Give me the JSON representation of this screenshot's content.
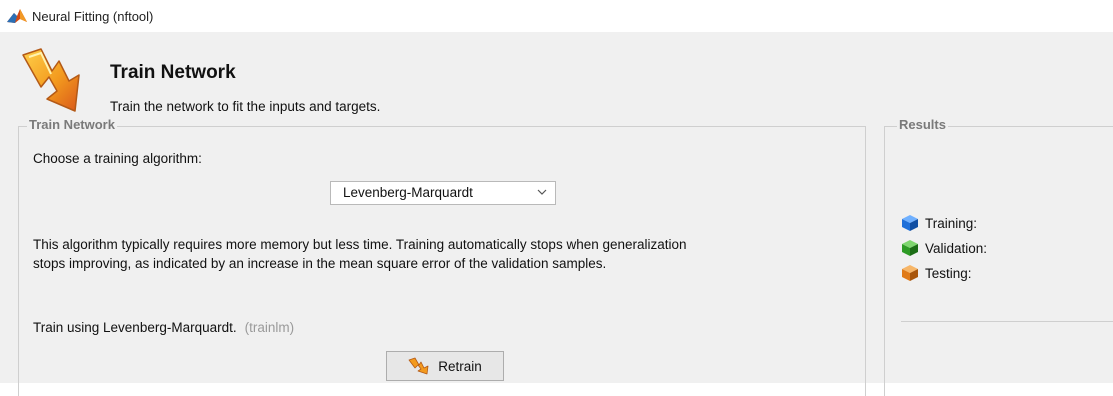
{
  "window": {
    "title": "Neural Fitting (nftool)"
  },
  "header": {
    "title": "Train Network",
    "subtitle": "Train the network to fit the inputs and targets."
  },
  "train_panel": {
    "label": "Train Network",
    "choose_label": "Choose a training algorithm:",
    "algorithm_selected": "Levenberg-Marquardt",
    "description_line1": "This algorithm typically requires more memory but less time. Training automatically stops when generalization",
    "description_line2": "stops improving, as indicated by an increase in the mean square error of the validation samples.",
    "train_using": "Train using Levenberg-Marquardt.",
    "algorithm_code": "(trainlm)",
    "retrain_label": "Retrain"
  },
  "results_panel": {
    "label": "Results",
    "rows": [
      {
        "label": "Training:",
        "icon": "blue-cube-icon",
        "color": "#1e6fd9"
      },
      {
        "label": "Validation:",
        "icon": "green-cube-icon",
        "color": "#2e9b25"
      },
      {
        "label": "Testing:",
        "icon": "orange-cube-icon",
        "color": "#e07a17"
      }
    ]
  },
  "colors": {
    "panel_bg": "#f0f0f0",
    "group_label": "#7a7a7a",
    "muted_text": "#9a9a9a"
  }
}
